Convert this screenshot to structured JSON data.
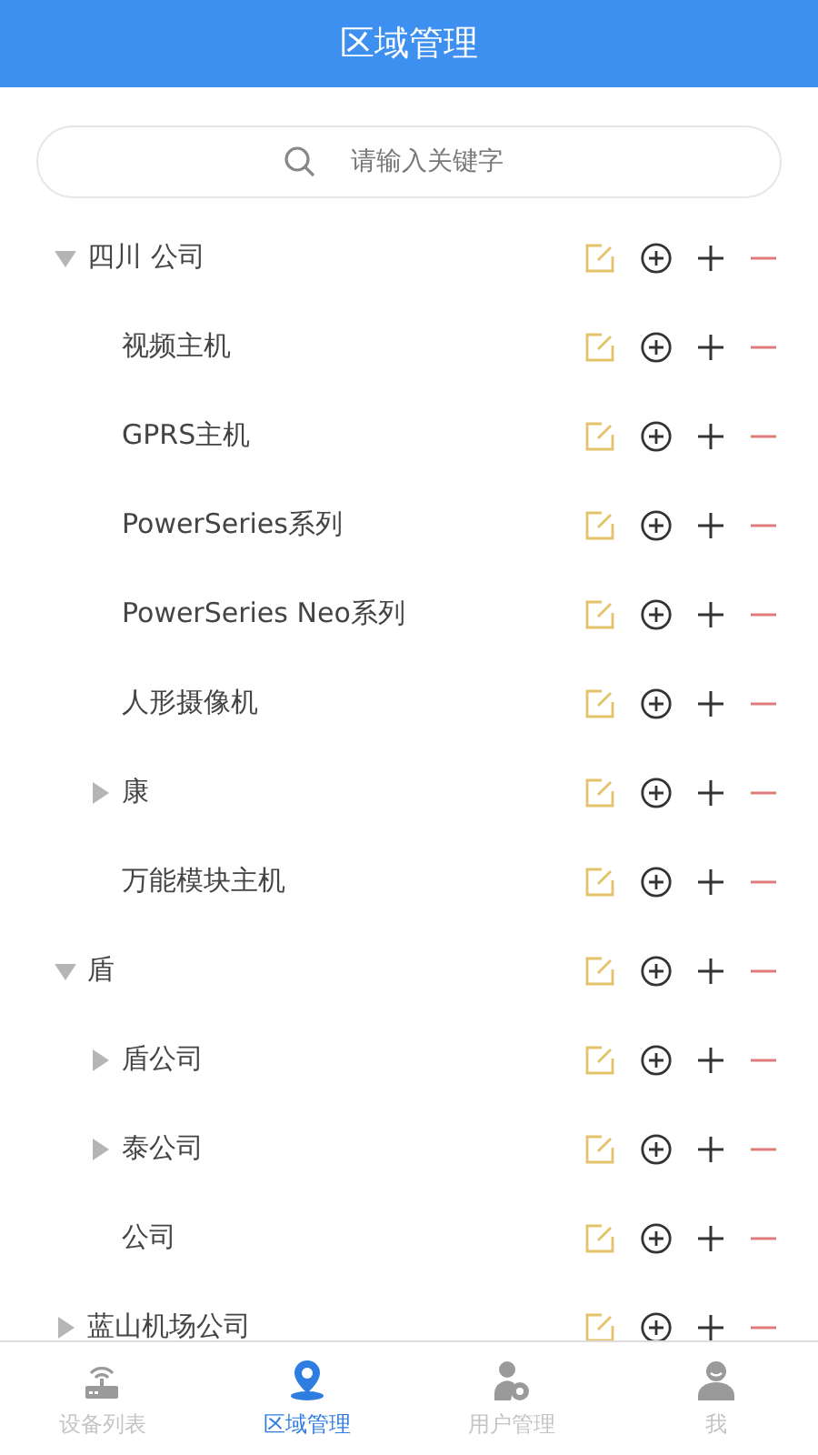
{
  "header": {
    "title": "区域管理"
  },
  "search": {
    "placeholder": "请输入关键字"
  },
  "tree": [
    {
      "label": "四川 公司",
      "expanded": true,
      "children": [
        {
          "label": "视频主机"
        },
        {
          "label": "GPRS主机"
        },
        {
          "label": "PowerSeries系列"
        },
        {
          "label": "PowerSeries Neo系列"
        },
        {
          "label": "人形摄像机"
        },
        {
          "label": "康",
          "expanded": false
        },
        {
          "label": "万能模块主机"
        }
      ]
    },
    {
      "label": "盾",
      "expanded": true,
      "children": [
        {
          "label": "盾公司",
          "expanded": false
        },
        {
          "label": "泰公司",
          "expanded": false
        },
        {
          "label": "公司"
        }
      ]
    },
    {
      "label": "蓝山机场公司",
      "expanded": false
    }
  ],
  "tabs": [
    {
      "label": "设备列表",
      "kind": "router",
      "selected": false
    },
    {
      "label": "区域管理",
      "kind": "pin",
      "selected": true
    },
    {
      "label": "用户管理",
      "kind": "usergear",
      "selected": false
    },
    {
      "label": "我",
      "kind": "user",
      "selected": false
    }
  ]
}
